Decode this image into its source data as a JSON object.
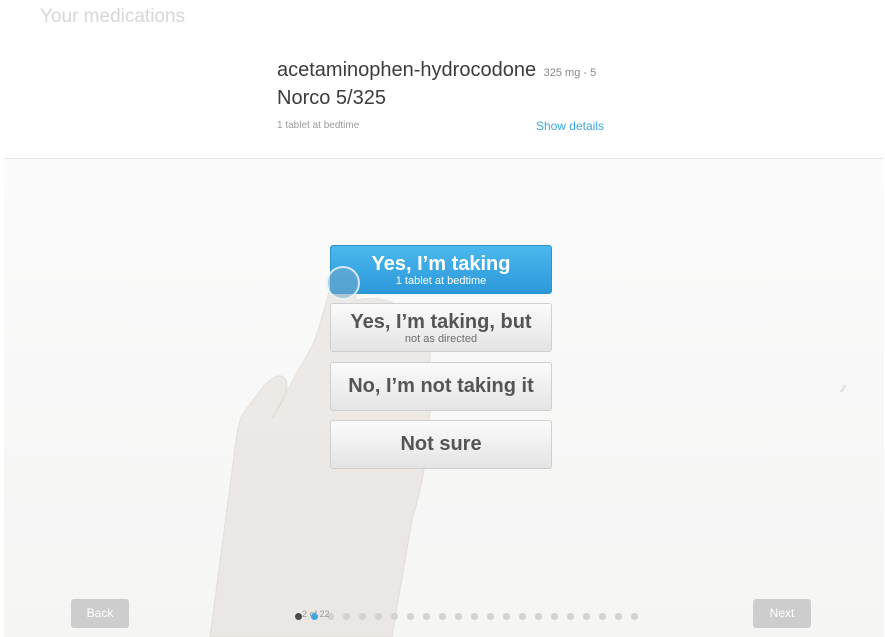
{
  "header": {
    "title": "Your medications"
  },
  "medication": {
    "name": "acetaminophen-hydrocodone",
    "dose": "325 mg - 5",
    "brand": "Norco 5/325",
    "instructions": "1 tablet at bedtime",
    "details_link": "Show details"
  },
  "answers": [
    {
      "label": "Yes, I’m taking",
      "sub": "1 tablet at bedtime",
      "selected": true
    },
    {
      "label": "Yes, I’m taking, but",
      "sub": "not as directed",
      "selected": false
    },
    {
      "label": "No, I’m not taking it",
      "sub": "",
      "selected": false
    },
    {
      "label": "Not sure",
      "sub": "",
      "selected": false
    }
  ],
  "navigation": {
    "back_label": "Back",
    "next_label": "Next",
    "progress_label": "2 of 22",
    "current_step": 2,
    "total_steps": 22
  },
  "colors": {
    "accent": "#36a5e0",
    "selected_button": "#3aa9e4",
    "nav_button": "#cdcdcd"
  },
  "icons": {
    "hand": "pointing-hand-icon",
    "touch": "touch-indicator-icon"
  }
}
